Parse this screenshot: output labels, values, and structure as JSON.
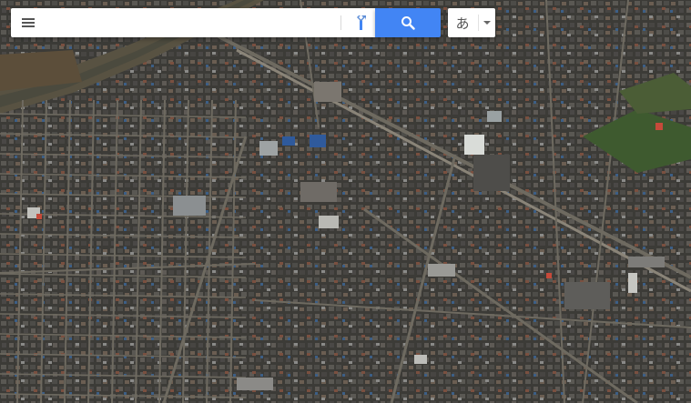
{
  "map": {
    "view": "satellite",
    "colors": {
      "ground": "#3a3a36",
      "road": "#6e6a60",
      "rail": "#8a8478"
    }
  },
  "search": {
    "value": "",
    "placeholder": "",
    "menu_icon": "hamburger-menu-icon",
    "directions_icon": "directions-icon",
    "search_icon": "magnifier-icon",
    "accent": "#4285f4"
  },
  "ime": {
    "label": "あ",
    "dropdown_icon": "caret-down-icon"
  }
}
